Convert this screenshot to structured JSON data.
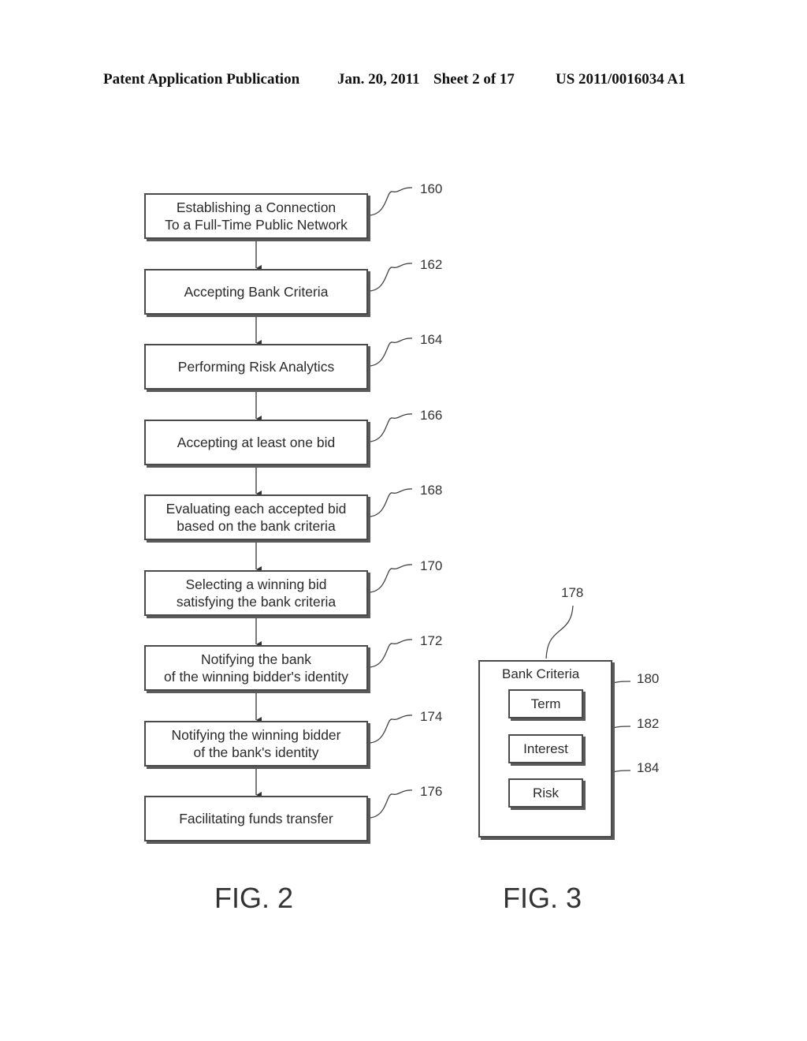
{
  "header": {
    "publication": "Patent Application Publication",
    "date": "Jan. 20, 2011",
    "sheet": "Sheet 2 of 17",
    "number": "US 2011/0016034 A1"
  },
  "fig2": {
    "caption": "FIG. 2",
    "steps": [
      {
        "ref": "160",
        "lines": [
          "Establishing a Connection",
          "To a Full-Time Public Network"
        ]
      },
      {
        "ref": "162",
        "lines": [
          "Accepting Bank Criteria"
        ]
      },
      {
        "ref": "164",
        "lines": [
          "Performing Risk Analytics"
        ]
      },
      {
        "ref": "166",
        "lines": [
          "Accepting at least one bid"
        ]
      },
      {
        "ref": "168",
        "lines": [
          "Evaluating each accepted bid",
          "based on the bank criteria"
        ]
      },
      {
        "ref": "170",
        "lines": [
          "Selecting a winning bid",
          "satisfying the bank criteria"
        ]
      },
      {
        "ref": "172",
        "lines": [
          "Notifying the bank",
          "of the winning bidder's identity"
        ]
      },
      {
        "ref": "174",
        "lines": [
          "Notifying the winning bidder",
          "of the bank's identity"
        ]
      },
      {
        "ref": "176",
        "lines": [
          "Facilitating funds transfer"
        ]
      }
    ]
  },
  "fig3": {
    "caption": "FIG. 3",
    "container_ref": "178",
    "title": "Bank Criteria",
    "items": [
      {
        "ref": "180",
        "label": "Term"
      },
      {
        "ref": "182",
        "label": "Interest"
      },
      {
        "ref": "184",
        "label": "Risk"
      }
    ]
  }
}
